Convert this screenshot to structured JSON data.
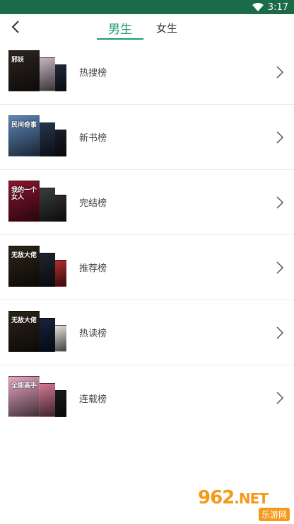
{
  "status_bar": {
    "time": "3:17",
    "wifi_icon": "wifi-icon"
  },
  "header": {
    "back_icon": "chevron-left-icon",
    "tabs": [
      {
        "label": "男生",
        "selected": true
      },
      {
        "label": "女生",
        "selected": false
      }
    ]
  },
  "rankings": [
    {
      "label": "热搜榜",
      "cover_text": "邪妖",
      "colors": [
        "#2d2520",
        "#c9b9c2",
        "#1f2a3a"
      ]
    },
    {
      "label": "新书榜",
      "cover_text": "民间奇事",
      "colors": [
        "#5d86b8",
        "#27354d",
        "#1b1e28"
      ]
    },
    {
      "label": "完结榜",
      "cover_text": "我的一个女人",
      "colors": [
        "#8b1430",
        "#3a3f3c",
        "#2d2a2a"
      ]
    },
    {
      "label": "推荐榜",
      "cover_text": "无敌大佬",
      "colors": [
        "#2b2418",
        "#1f2530",
        "#b82d2d"
      ]
    },
    {
      "label": "热读榜",
      "cover_text": "无敌大佬",
      "colors": [
        "#2b2418",
        "#16243e",
        "#e8e6e0"
      ]
    },
    {
      "label": "连载榜",
      "cover_text": "全能高手",
      "colors": [
        "#e8a6c4",
        "#d87a98",
        "#1b1b1b"
      ]
    }
  ],
  "watermark": {
    "brand": "962",
    "suffix": ".NET",
    "site": "乐游网"
  },
  "colors": {
    "status_bar": "#1b6b48",
    "accent": "#1f9a6a",
    "watermark": "#f39a1a"
  }
}
